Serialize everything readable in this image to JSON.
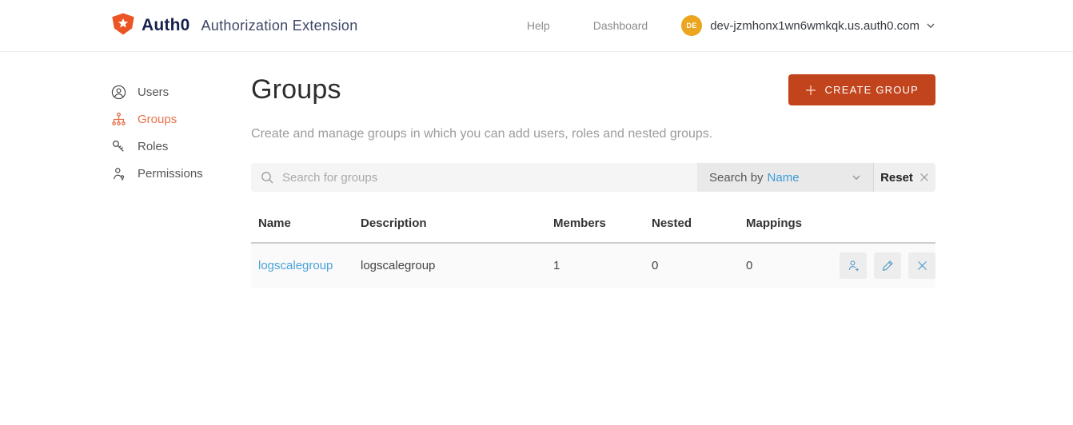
{
  "header": {
    "brand": "Auth0",
    "app_title": "Authorization Extension",
    "nav": {
      "help": "Help",
      "dashboard": "Dashboard"
    },
    "account": {
      "avatar_initials": "DE",
      "domain": "dev-jzmhonx1wn6wmkqk.us.auth0.com"
    }
  },
  "sidebar": {
    "items": [
      {
        "label": "Users",
        "icon": "user-icon",
        "active": false
      },
      {
        "label": "Groups",
        "icon": "hierarchy-icon",
        "active": true
      },
      {
        "label": "Roles",
        "icon": "keys-icon",
        "active": false
      },
      {
        "label": "Permissions",
        "icon": "person-key-icon",
        "active": false
      }
    ]
  },
  "main": {
    "title": "Groups",
    "create_button_label": "CREATE GROUP",
    "description": "Create and manage groups in which you can add users, roles and nested groups.",
    "search": {
      "placeholder": "Search for groups",
      "search_by_label": "Search by",
      "search_by_value": "Name",
      "reset_label": "Reset"
    },
    "table": {
      "columns": [
        "Name",
        "Description",
        "Members",
        "Nested",
        "Mappings"
      ],
      "rows": [
        {
          "name": "logscalegroup",
          "description": "logscalegroup",
          "members": "1",
          "nested": "0",
          "mappings": "0"
        }
      ]
    }
  },
  "colors": {
    "brand_orange": "#eb5424",
    "button_orange": "#c2441c",
    "active_nav_orange": "#e8714b",
    "link_blue": "#4aa2d9",
    "filter_blue": "#3b9bd8",
    "avatar_amber": "#eba51e",
    "brand_navy": "#16214d"
  }
}
